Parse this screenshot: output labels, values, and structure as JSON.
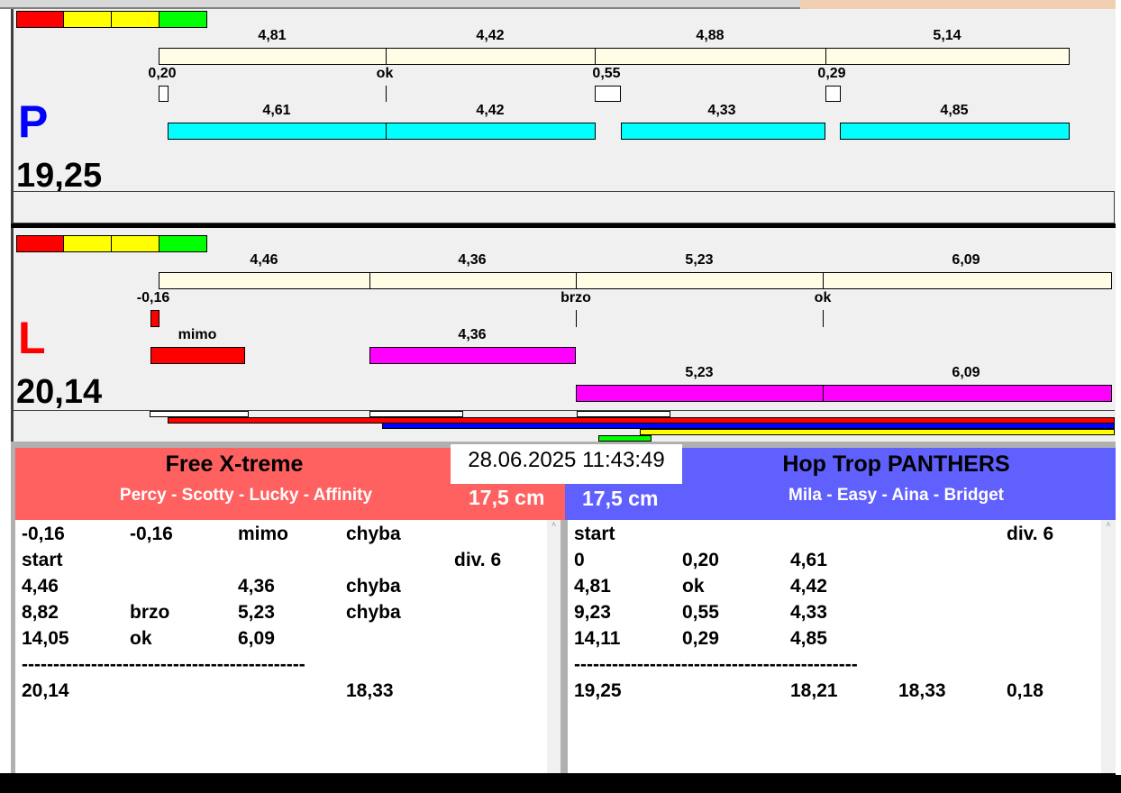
{
  "colors": {
    "legend": [
      "#ff0000",
      "#ffff00",
      "#ffff00",
      "#00ff00"
    ],
    "track": "#fffde6",
    "cyan": "#00ffff",
    "magenta": "#ff00ff",
    "left_team": "#ff6060",
    "right_team": "#6060ff"
  },
  "p_panel": {
    "letter": "P",
    "total": "19,25",
    "top_labels": [
      "4,81",
      "4,42",
      "4,88",
      "5,14"
    ],
    "mid_labels": [
      "0,20",
      "ok",
      "0,55",
      "0,29"
    ],
    "bottom_labels": [
      "4,61",
      "4,42",
      "4,33",
      "4,85"
    ]
  },
  "l_panel": {
    "letter": "L",
    "total": "20,14",
    "top_labels": [
      "4,46",
      "4,36",
      "5,23",
      "6,09"
    ],
    "mid_labels": [
      "-0,16",
      "brzo",
      "ok"
    ],
    "row2_labels": [
      "mimo",
      "4,36"
    ],
    "row3_labels": [
      "5,23",
      "6,09"
    ]
  },
  "datetime": "28.06.2025 11:43:49",
  "left_team": {
    "name": "Free X-treme",
    "dogs": "Percy - Scotty - Lucky - Affinity",
    "height": "17,5 cm",
    "rows": [
      [
        "-0,16",
        "-0,16",
        "mimo",
        "chyba",
        ""
      ],
      [
        "start",
        "",
        "",
        "",
        "div.  6"
      ],
      [
        "4,46",
        "",
        "4,36",
        "chyba",
        ""
      ],
      [
        "8,82",
        "brzo",
        "5,23",
        "chyba",
        ""
      ],
      [
        "14,05",
        "ok",
        "6,09",
        "",
        ""
      ],
      [
        "---------------------------------------------",
        "",
        "",
        "",
        ""
      ],
      [
        "20,14",
        "",
        "",
        "18,33",
        ""
      ]
    ]
  },
  "right_team": {
    "name": "Hop Trop PANTHERS",
    "dogs": "Mila - Easy - Aina - Bridget",
    "height": "17,5 cm",
    "rows": [
      [
        "start",
        "",
        "",
        "",
        "div.  6"
      ],
      [
        "0",
        "0,20",
        "4,61",
        "",
        ""
      ],
      [
        "4,81",
        "ok",
        "4,42",
        "",
        ""
      ],
      [
        "9,23",
        "0,55",
        "4,33",
        "",
        ""
      ],
      [
        "14,11",
        "0,29",
        "4,85",
        "",
        ""
      ],
      [
        "---------------------------------------------",
        "",
        "",
        "",
        ""
      ],
      [
        "19,25",
        "",
        "18,21",
        "18,33",
        "0,18"
      ]
    ]
  }
}
